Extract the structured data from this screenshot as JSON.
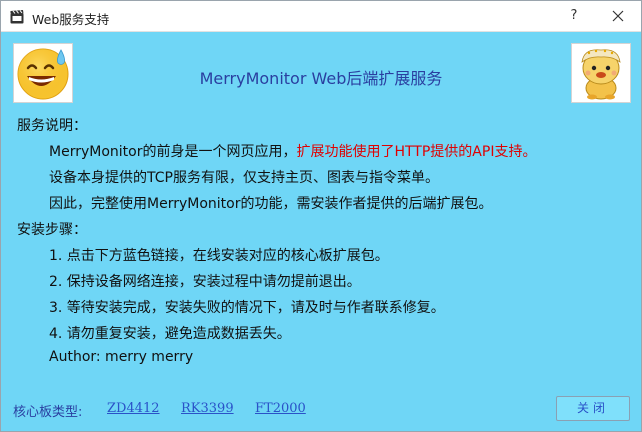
{
  "window": {
    "title": "Web服务支持",
    "help_label": "?",
    "icons": {
      "app": "clapperboard-icon",
      "close": "close-icon"
    }
  },
  "header": {
    "title": "MerryMonitor Web后端扩展服务",
    "avatar_left": "smiling-sweat-emoji",
    "avatar_right": "cartoon-character"
  },
  "service": {
    "label": "服务说明：",
    "line1_normal": "MerryMonitor的前身是一个网页应用，",
    "line1_highlight": "扩展功能使用了HTTP提供的API支持。",
    "line2": "设备本身提供的TCP服务有限，仅支持主页、图表与指令菜单。",
    "line3": "因此，完整使用MerryMonitor的功能，需安装作者提供的后端扩展包。",
    "highlight_color": "#e00000"
  },
  "install": {
    "label": "安装步骤：",
    "steps": [
      "1. 点击下方蓝色链接，在线安装对应的核心板扩展包。",
      "2. 保持设备网络连接，安装过程中请勿提前退出。",
      "3. 等待安装完成，安装失败的情况下，请及时与作者联系修复。",
      "4. 请勿重复安装，避免造成数据丢失。"
    ],
    "author": "Author: merry merry"
  },
  "footer": {
    "board_label": "核心板类型:",
    "links": [
      "ZD4412",
      "RK3399",
      "FT2000"
    ],
    "close_label": "关闭"
  },
  "colors": {
    "background": "#6fd6f6",
    "title_blue": "#2a3fa0",
    "link_blue": "#2a52c8"
  }
}
